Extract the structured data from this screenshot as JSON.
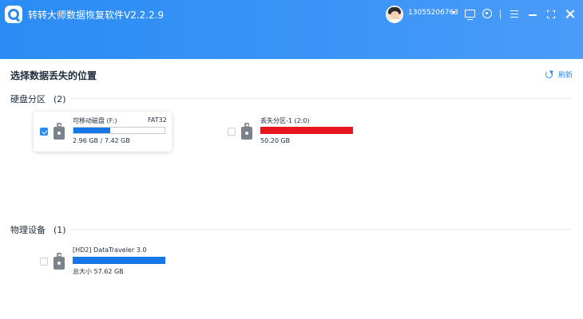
{
  "window": {
    "title": "转转大师数据恢复软件V2.2.2.9",
    "user_phone": "13055206763",
    "icons": [
      "app-logo-icon",
      "user-avatar",
      "chevron-down-icon",
      "message-icon",
      "support-icon",
      "menu-icon",
      "minimize-icon",
      "maximize-icon",
      "close-icon"
    ]
  },
  "colors": {
    "header": "#2a8cf4",
    "accent": "#2a8cf4",
    "bar_used": "#1677e8",
    "bar_lost": "#e5161d",
    "bar_physical": "#1677e8"
  },
  "page": {
    "title": "选择数据丢失的位置",
    "refresh_label": "刷新"
  },
  "partitions": {
    "title": "硬盘分区",
    "count": "(2)",
    "items": [
      {
        "name": "可移动磁盘 (F:)",
        "filesystem": "FAT32",
        "size": "2.96 GB / 7.42 GB",
        "used_fraction": 0.4,
        "checked": true,
        "bar_color": "#1677e8"
      },
      {
        "name": "丢失分区-1 (2:0)",
        "filesystem": "",
        "size": "50.20 GB",
        "used_fraction": 1.0,
        "checked": false,
        "bar_color": "#e5161d"
      }
    ]
  },
  "physical": {
    "title": "物理设备",
    "count": "(1)",
    "items": [
      {
        "name": "[HD2] DataTraveler 3.0",
        "size": "总大小 57.62 GB",
        "used_fraction": 1.0,
        "checked": false,
        "bar_color": "#1677e8"
      }
    ]
  }
}
